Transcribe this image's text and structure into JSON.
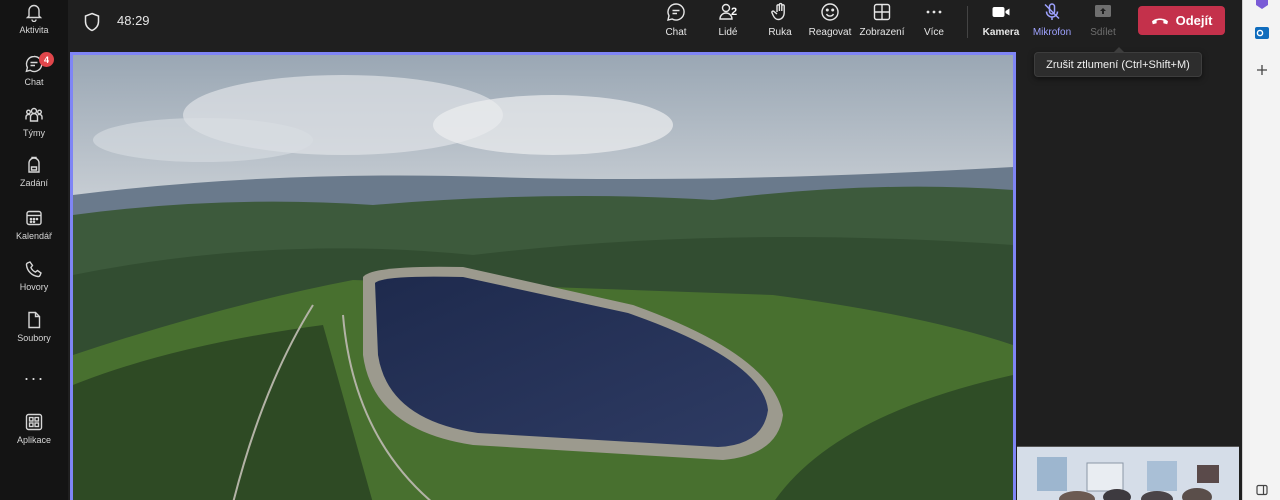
{
  "rail": {
    "items": [
      {
        "label": "Aktivita",
        "icon": "bell-icon"
      },
      {
        "label": "Chat",
        "icon": "chat-icon",
        "badge": "4"
      },
      {
        "label": "Týmy",
        "icon": "teams-icon"
      },
      {
        "label": "Zadání",
        "icon": "backpack-icon"
      },
      {
        "label": "Kalendář",
        "icon": "calendar-icon"
      },
      {
        "label": "Hovory",
        "icon": "phone-icon"
      },
      {
        "label": "Soubory",
        "icon": "file-icon"
      },
      {
        "label": "Aplikace",
        "icon": "apps-icon"
      }
    ],
    "more": "···"
  },
  "meeting": {
    "timer": "48:29",
    "toolbar": {
      "chat": "Chat",
      "people": "Lidé",
      "people_count": "2",
      "hand": "Ruka",
      "react": "Reagovat",
      "view": "Zobrazení",
      "more": "Více",
      "camera": "Kamera",
      "mic": "Mikrofon",
      "share": "Sdílet",
      "leave": "Odejít"
    },
    "tooltip": "Zrušit ztlumení (Ctrl+Shift+M)"
  },
  "colors": {
    "accent": "#7f85f5",
    "leave": "#c4314b",
    "badge": "#e0464b"
  }
}
